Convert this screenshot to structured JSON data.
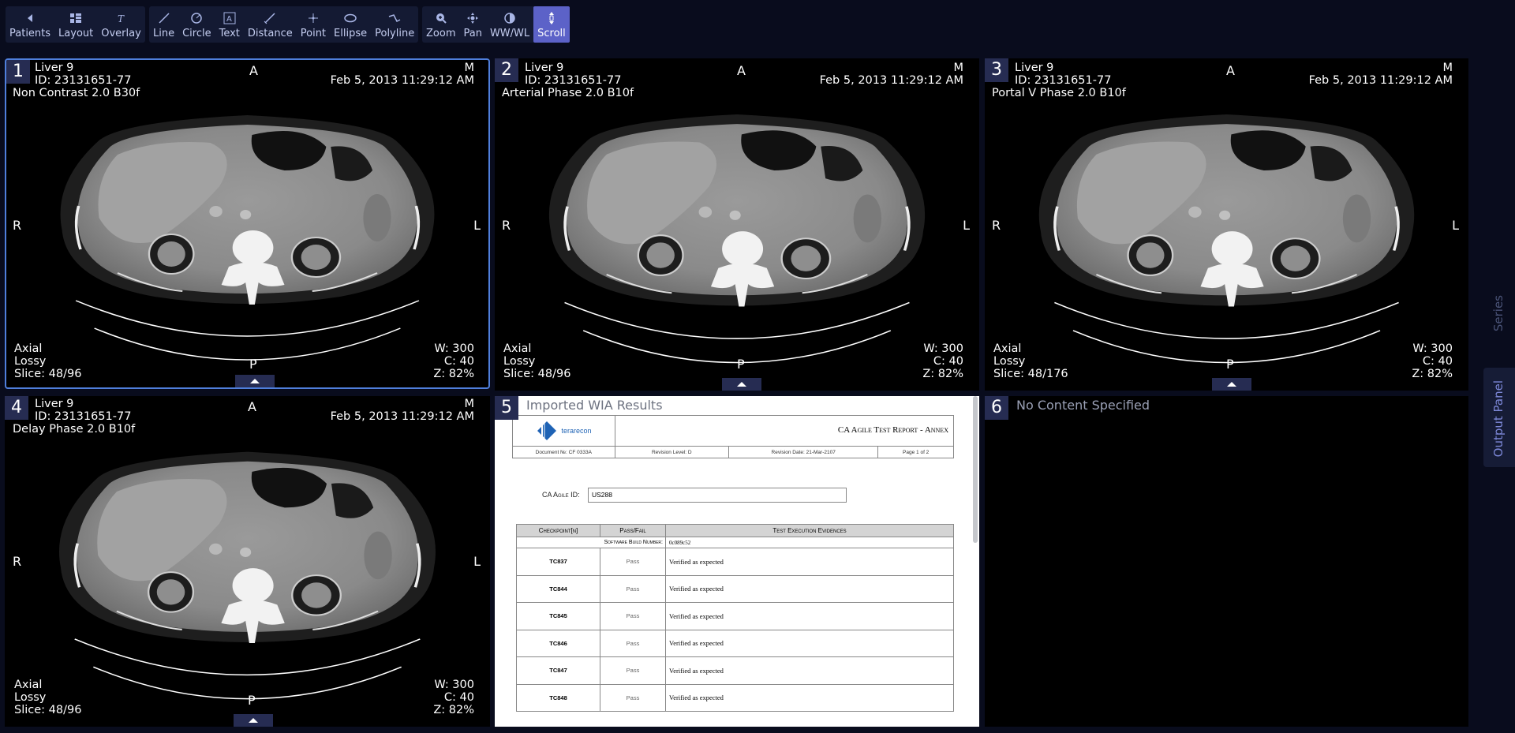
{
  "toolbar": {
    "groups": [
      [
        {
          "label": "Patients",
          "icon": "back-icon"
        },
        {
          "label": "Layout",
          "icon": "grid-icon"
        },
        {
          "label": "Overlay",
          "icon": "overlay-icon"
        }
      ],
      [
        {
          "label": "Line",
          "icon": "line-icon"
        },
        {
          "label": "Circle",
          "icon": "circle-icon"
        },
        {
          "label": "Text",
          "icon": "text-icon"
        },
        {
          "label": "Distance",
          "icon": "ruler-icon"
        },
        {
          "label": "Point",
          "icon": "point-icon"
        },
        {
          "label": "Ellipse",
          "icon": "ellipse-icon"
        },
        {
          "label": "Polyline",
          "icon": "polyline-icon"
        }
      ],
      [
        {
          "label": "Zoom",
          "icon": "zoom-icon"
        },
        {
          "label": "Pan",
          "icon": "pan-icon"
        },
        {
          "label": "WW/WL",
          "icon": "contrast-icon"
        },
        {
          "label": "Scroll",
          "icon": "scroll-icon",
          "active": true
        }
      ]
    ]
  },
  "viewports": [
    {
      "num": "1",
      "patient": "Liver 9",
      "id": "ID: 23131651-77",
      "series": "Non Contrast 2.0 B30f",
      "sex": "M",
      "date": "Feb 5, 2013 11:29:12 AM",
      "plane": "Axial",
      "compression": "Lossy",
      "slice": "Slice: 48/96",
      "ww": "W: 300",
      "wl": "C: 40",
      "zoom": "Z: 82%",
      "top": "A",
      "bottom": "P",
      "left": "R",
      "right": "L",
      "selected": true
    },
    {
      "num": "2",
      "patient": "Liver 9",
      "id": "ID: 23131651-77",
      "series": "Arterial Phase 2.0 B10f",
      "sex": "M",
      "date": "Feb 5, 2013 11:29:12 AM",
      "plane": "Axial",
      "compression": "Lossy",
      "slice": "Slice: 48/96",
      "ww": "W: 300",
      "wl": "C: 40",
      "zoom": "Z: 82%",
      "top": "A",
      "bottom": "P",
      "left": "R",
      "right": "L"
    },
    {
      "num": "3",
      "patient": "Liver 9",
      "id": "ID: 23131651-77",
      "series": "Portal V Phase 2.0 B10f",
      "sex": "M",
      "date": "Feb 5, 2013 11:29:12 AM",
      "plane": "Axial",
      "compression": "Lossy",
      "slice": "Slice: 48/176",
      "ww": "W: 300",
      "wl": "C: 40",
      "zoom": "Z: 82%",
      "top": "A",
      "bottom": "P",
      "left": "R",
      "right": "L"
    },
    {
      "num": "4",
      "patient": "Liver 9",
      "id": "ID: 23131651-77",
      "series": "Delay Phase 2.0 B10f",
      "sex": "M",
      "date": "Feb 5, 2013 11:29:12 AM",
      "plane": "Axial",
      "compression": "Lossy",
      "slice": "Slice: 48/96",
      "ww": "W: 300",
      "wl": "C: 40",
      "zoom": "Z: 82%",
      "top": "A",
      "bottom": "P",
      "left": "R",
      "right": "L"
    }
  ],
  "report_panel": {
    "num": "5",
    "title": "Imported WIA Results",
    "logo_text": "terarecon",
    "report_title": "CA Agile Test Report - Annex",
    "meta": {
      "doc": "Document №: CF 0333A",
      "rev": "Revision Level: D",
      "date": "Revision Date: 21-Mar-2107",
      "page": "Page 1 of 2"
    },
    "agile_id_label": "CA Agile ID:",
    "agile_id_value": "US288",
    "headers": [
      "Checkpoint[n]",
      "Pass/Fail",
      "Test Execution Evidences"
    ],
    "build_label": "Software Build Number:",
    "build_value": "0c089c52",
    "rows": [
      {
        "tc": "TC837",
        "result": "Pass",
        "evidence": "Verified as expected"
      },
      {
        "tc": "TC844",
        "result": "Pass",
        "evidence": "Verified as expected"
      },
      {
        "tc": "TC845",
        "result": "Pass",
        "evidence": "Verified as expected"
      },
      {
        "tc": "TC846",
        "result": "Pass",
        "evidence": "Verified as expected"
      },
      {
        "tc": "TC847",
        "result": "Pass",
        "evidence": "Verified as expected"
      },
      {
        "tc": "TC848",
        "result": "Pass",
        "evidence": "Verified as expected"
      }
    ]
  },
  "empty_panel": {
    "num": "6",
    "label": "No Content Specified"
  },
  "side_tabs": {
    "series": "Series",
    "output": "Output Panel"
  }
}
